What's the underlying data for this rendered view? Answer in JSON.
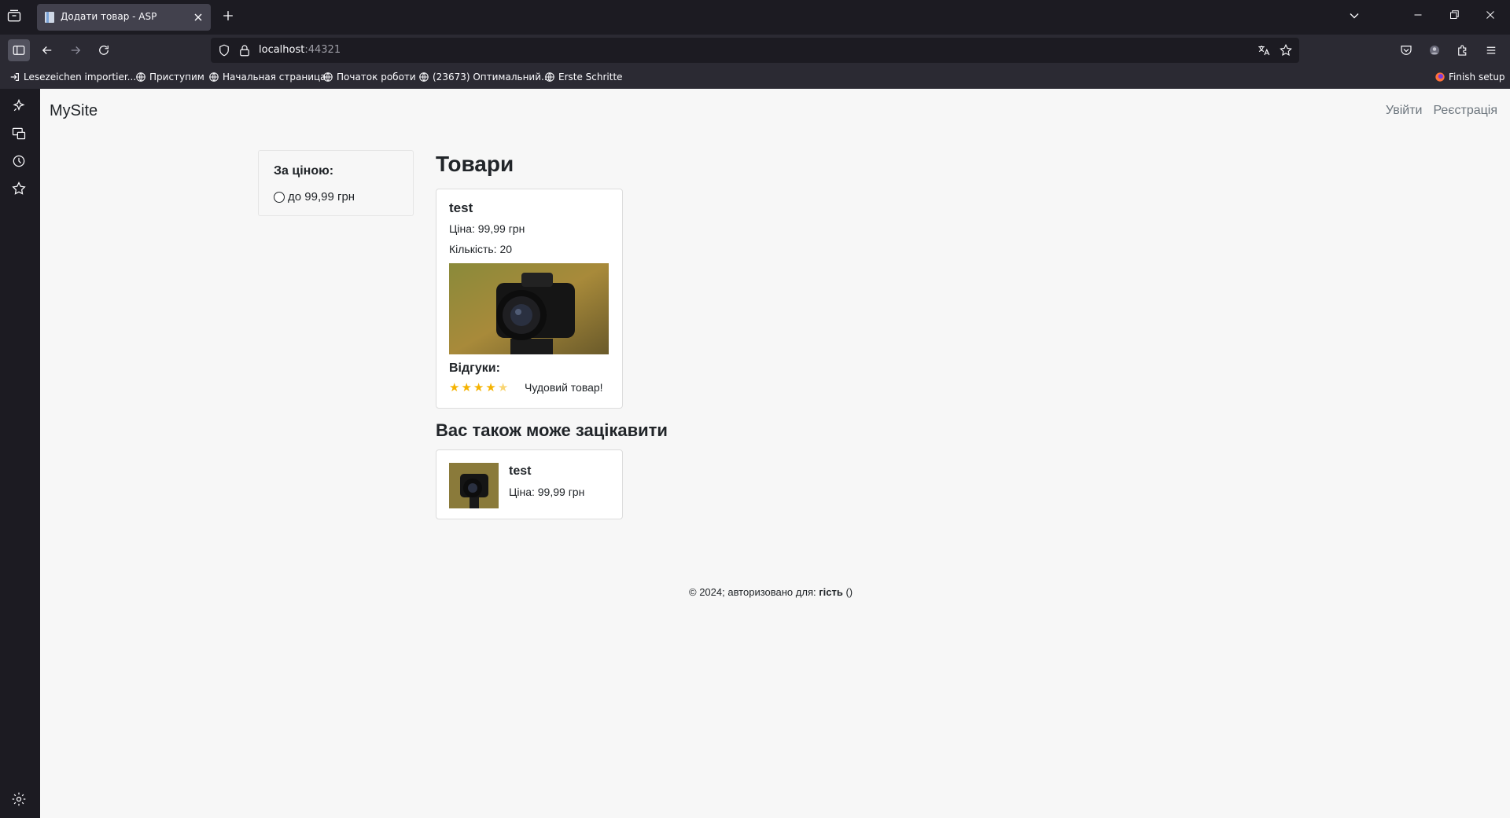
{
  "browser": {
    "tab_title": "Додати товар - ASP",
    "url_host": "localhost",
    "url_port": ":44321",
    "bookmarks": [
      "Lesezeichen importier...",
      "Приступим",
      "Начальная страница",
      "Початок роботи",
      "(23673) Оптимальний...",
      "Erste Schritte"
    ],
    "finish_setup": "Finish setup"
  },
  "site": {
    "brand": "MySite",
    "nav": {
      "login": "Увійти",
      "register": "Реєстрація"
    }
  },
  "filter": {
    "title": "За ціною:",
    "option": "до 99,99 грн"
  },
  "products": {
    "heading": "Товари",
    "items": [
      {
        "name": "test",
        "price": "Ціна: 99,99 грн",
        "quantity": "Кількість: 20",
        "reviews_title": "Відгуки:",
        "rating": 4.5,
        "review_text": "Чудовий товар!"
      }
    ]
  },
  "recommended": {
    "heading": "Вас також може зацікавити",
    "items": [
      {
        "name": "test",
        "price": "Ціна: 99,99 грн"
      }
    ]
  },
  "footer": {
    "text": "© 2024; авторизовано для: ",
    "user": "гість",
    "suffix": " ()"
  },
  "colors": {
    "star": "#f5b301",
    "page_bg": "#f7f7f7",
    "chrome_dark": "#1c1b22"
  }
}
